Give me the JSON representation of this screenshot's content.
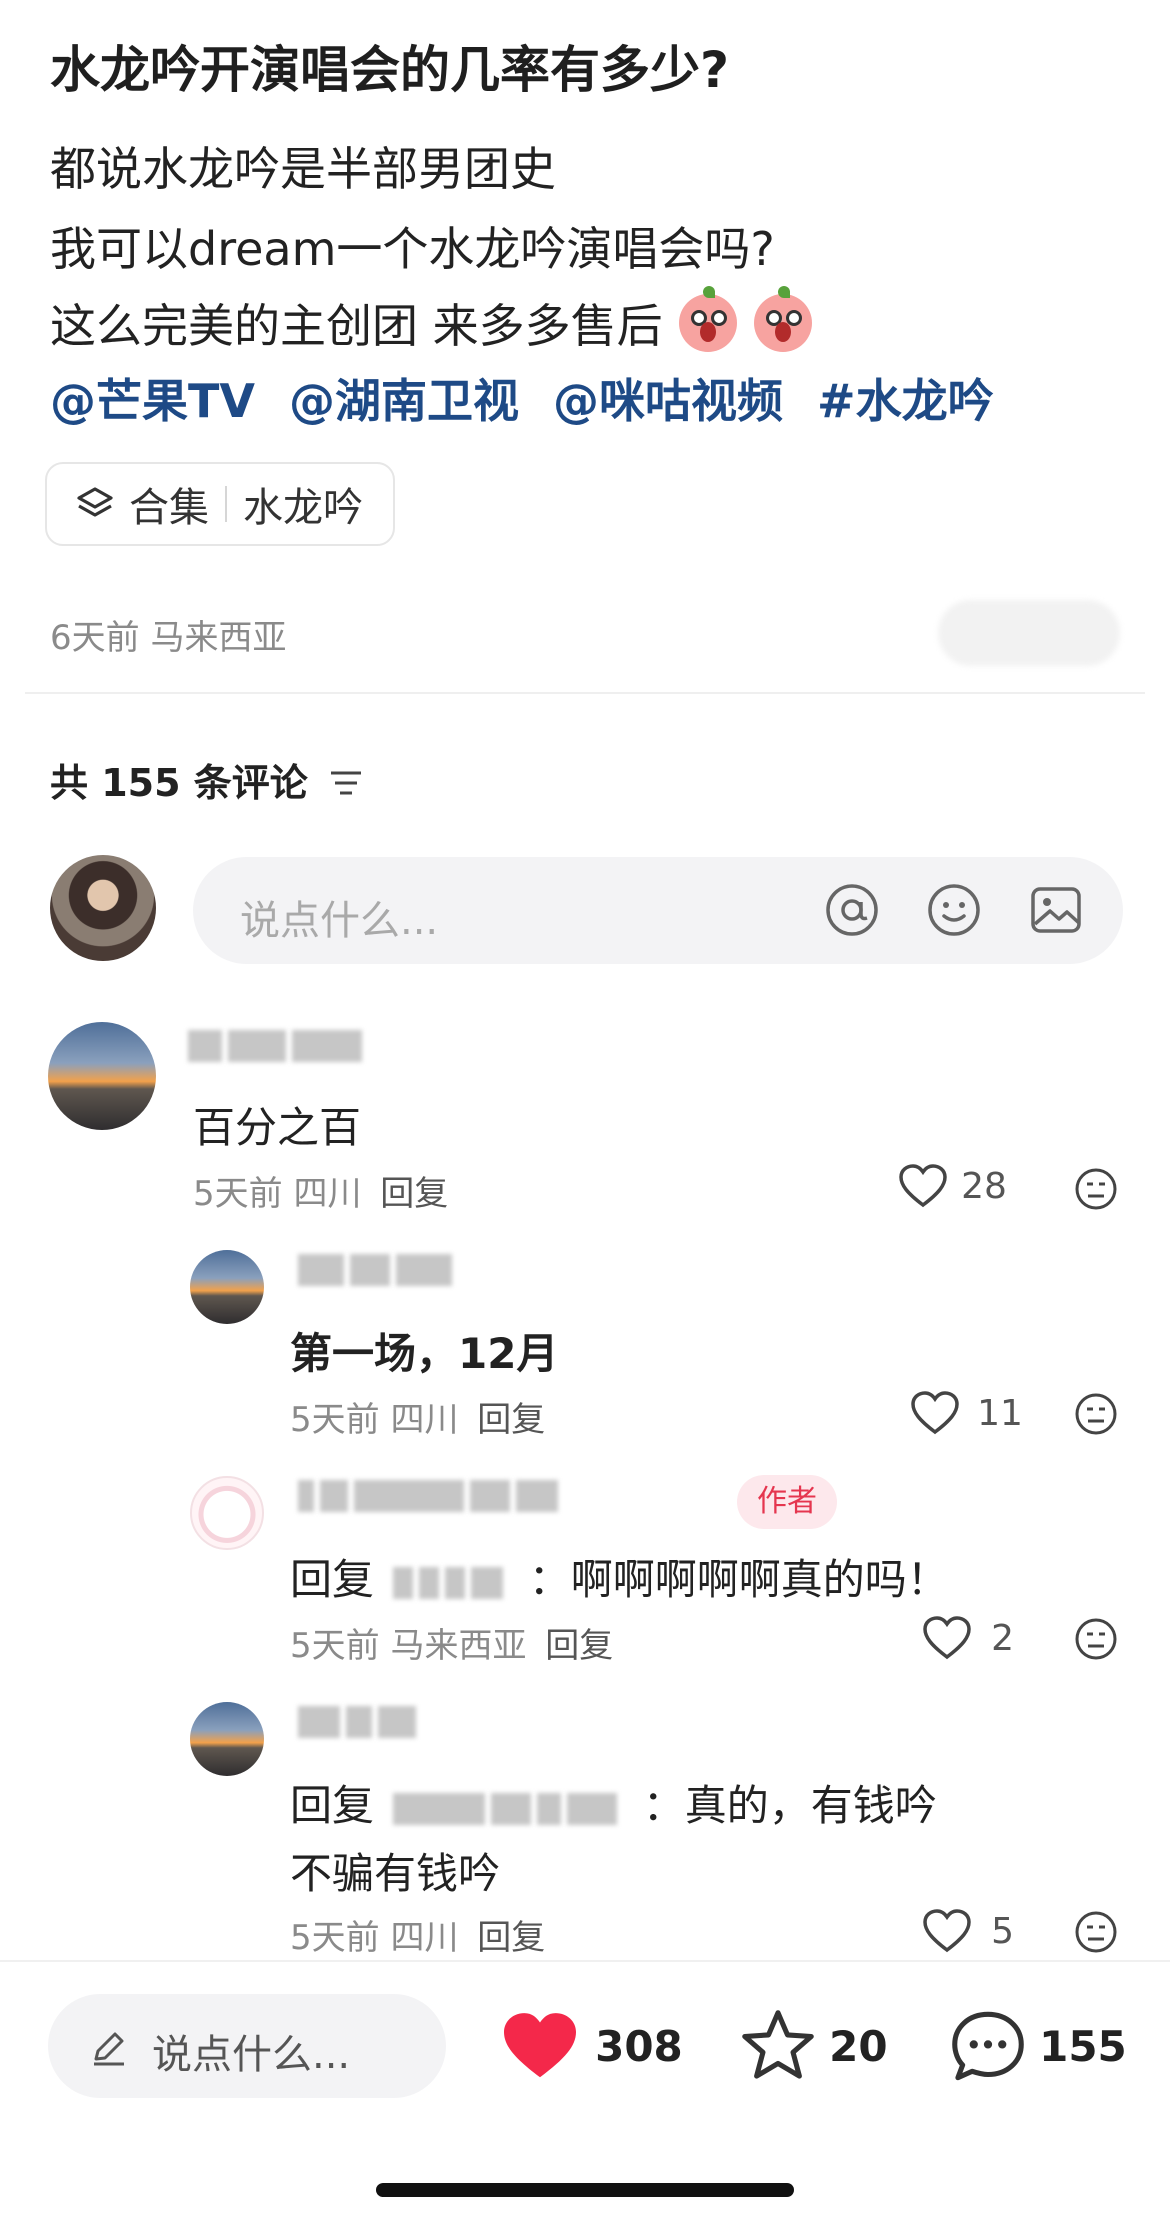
{
  "post": {
    "title": "水龙吟开演唱会的几率有多少?",
    "lines": [
      "都说水龙吟是半部男团史",
      "我可以dream一个水龙吟演唱会吗?",
      "这么完美的主创团 来多多售后"
    ],
    "mentions": [
      "@芒果TV",
      "@湖南卫视",
      "@咪咕视频",
      "#水龙吟"
    ],
    "collection_label": "合集",
    "collection_name": "水龙吟",
    "meta": "6天前 马来西亚"
  },
  "comments_header": {
    "count_text": "共 155 条评论"
  },
  "composer": {
    "placeholder": "说点什么..."
  },
  "comments": [
    {
      "text": "百分之百",
      "meta": "5天前 四川",
      "reply": "回复",
      "likes": "28"
    },
    {
      "text": "第一场，12月",
      "meta": "5天前 四川",
      "reply": "回复",
      "likes": "11"
    },
    {
      "badge": "作者",
      "prefix": "回复",
      "text": "：啊啊啊啊啊真的吗！",
      "meta": "5天前 马来西亚",
      "reply": "回复",
      "likes": "2"
    },
    {
      "prefix": "回复",
      "text": "：真的，有钱吟",
      "text2": "不骗有钱吟",
      "meta": "5天前 四川",
      "reply": "回复",
      "likes": "5"
    }
  ],
  "bottom_bar": {
    "placeholder": "说点什么...",
    "likes": "308",
    "favorites": "20",
    "comments": "155"
  },
  "colors": {
    "accent_link": "#1e4a86",
    "like_red": "#f4284a",
    "author_badge": "#e5364f"
  },
  "icons": [
    "layers-icon",
    "filter-icon",
    "at-icon",
    "emoji-icon",
    "image-icon",
    "heart-icon",
    "star-icon",
    "comment-icon",
    "pencil-icon",
    "sad-emoji-icon"
  ]
}
